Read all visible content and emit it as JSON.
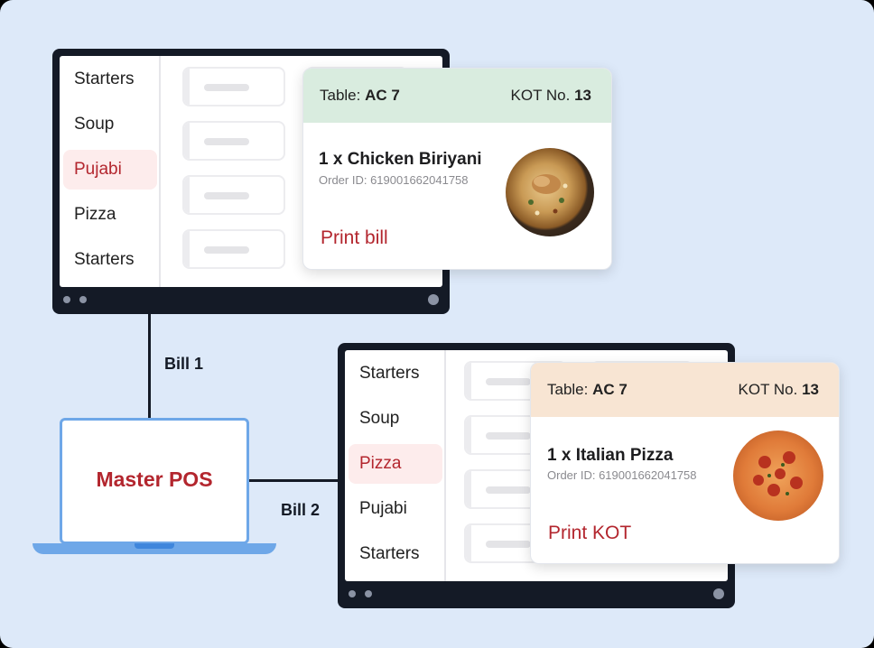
{
  "master": {
    "label": "Master POS"
  },
  "connections": {
    "bill1": "Bill 1",
    "bill2": "Bill 2"
  },
  "pos1": {
    "menu": [
      "Starters",
      "Soup",
      "Pujabi",
      "Pizza",
      "Starters"
    ],
    "active_index": 2
  },
  "pos2": {
    "menu": [
      "Starters",
      "Soup",
      "Pizza",
      "Pujabi",
      "Starters"
    ],
    "active_index": 2
  },
  "card1": {
    "table_label": "Table:",
    "table_value": "AC 7",
    "kot_label": "KOT No.",
    "kot_value": "13",
    "item": "1 x Chicken Biriyani",
    "order_id": "Order ID: 619001662041758",
    "action": "Print bill",
    "header_color": "#d9ecdf",
    "dish_icon": "biriyani-plate-icon"
  },
  "card2": {
    "table_label": "Table:",
    "table_value": "AC 7",
    "kot_label": "KOT No.",
    "kot_value": "13",
    "item": "1 x Italian Pizza",
    "order_id": "Order ID: 619001662041758",
    "action": "Print KOT",
    "header_color": "#f8e5d3",
    "dish_icon": "pizza-icon"
  },
  "colors": {
    "accent": "#b3262e",
    "frame": "#141a26",
    "laptop": "#6ea7e8",
    "background": "#dde9f9"
  }
}
